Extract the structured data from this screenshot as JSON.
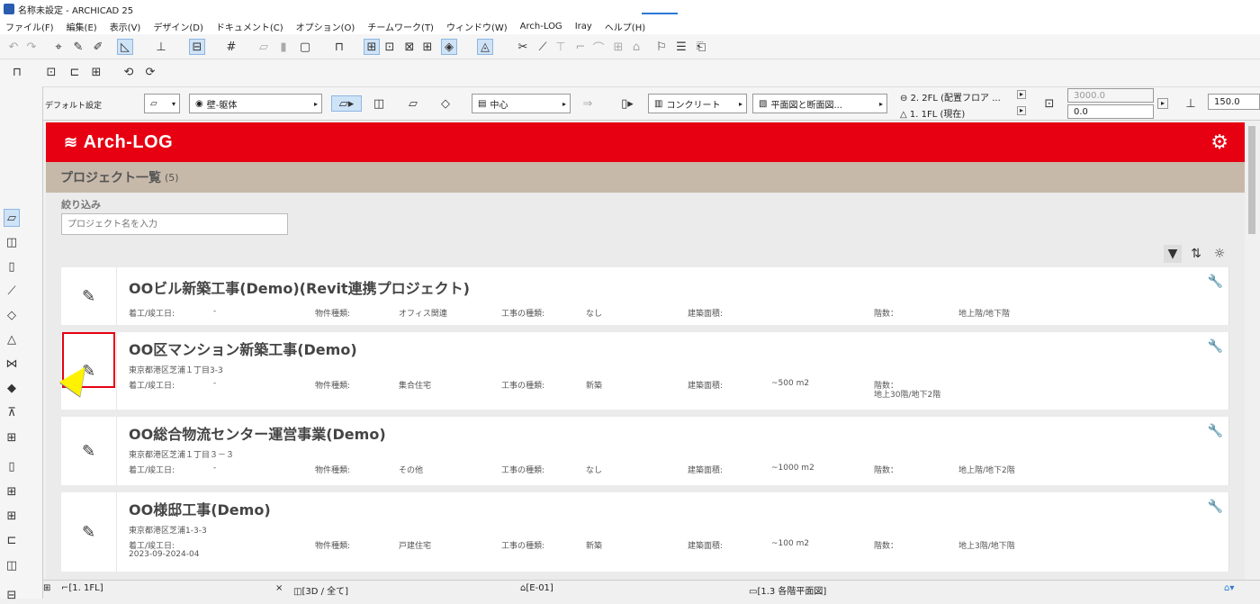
{
  "window": {
    "title": "名称未設定 - ARCHICAD 25"
  },
  "menu": [
    "ファイル(F)",
    "編集(E)",
    "表示(V)",
    "デザイン(D)",
    "ドキュメント(C)",
    "オプション(O)",
    "チームワーク(T)",
    "ウィンドウ(W)",
    "Arch-LOG",
    "Iray",
    "ヘルプ(H)"
  ],
  "infobox": {
    "default_label": "デフォルト設定",
    "layer": "壁-躯体",
    "ref_line": "中心",
    "material": "コンクリート",
    "view": "平面図と断面図...",
    "story_top": "2. 2FL (配置フロア ...",
    "story_bottom": "1. 1FL (現在)",
    "height": "3000.0",
    "offset": "0.0",
    "thickness": "150.0"
  },
  "archlog": {
    "logo": "Arch-LOG",
    "list_title": "プロジェクト一覧",
    "list_count": "(5)",
    "filter_label": "絞り込み",
    "filter_placeholder": "プロジェクト名を入力"
  },
  "labels": {
    "date": "着工/竣工日:",
    "type": "物件種類:",
    "work": "工事の種類:",
    "area": "建築面積:",
    "floors": "階数："
  },
  "projects": [
    {
      "title": "OOビル新築工事(Demo)(Revit連携プロジェクト)",
      "address": "",
      "date": "-",
      "type": "オフィス関連",
      "work": "なし",
      "area": "",
      "floors": "地上階/地下階",
      "floors2": ""
    },
    {
      "title": "OO区マンション新築工事(Demo)",
      "address": "東京都港区芝浦１丁目3-3",
      "date": "-",
      "type": "集合住宅",
      "work": "新築",
      "area": "~500 m2",
      "floors": "",
      "floors2": "地上30階/地下2階"
    },
    {
      "title": "OO総合物流センター運営事業(Demo)",
      "address": "東京都港区芝浦１丁目３－３",
      "date": "-",
      "type": "その他",
      "work": "なし",
      "area": "~1000 m2",
      "floors": "地上階/地下2階",
      "floors2": ""
    },
    {
      "title": "OO様邸工事(Demo)",
      "address": "東京都港区芝浦1-3-3",
      "date": "2023-09-2024-04",
      "type": "戸建住宅",
      "work": "新築",
      "area": "~100 m2",
      "floors": "地上3階/地下階",
      "floors2": ""
    }
  ],
  "tabs": {
    "t1": "[1. 1FL]",
    "close": "×",
    "t2": "[3D / 全て]",
    "t3": "[E-01]",
    "t4": "[1.3 各階平面図]"
  }
}
